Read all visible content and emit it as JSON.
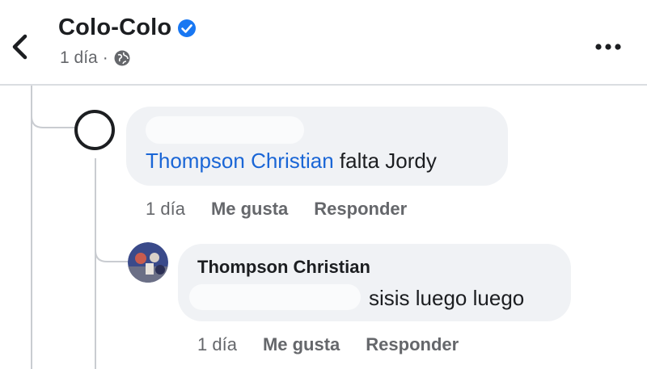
{
  "header": {
    "title": "Colo-Colo",
    "time": "1 día",
    "separator": "·"
  },
  "comments": [
    {
      "mention": "Thompson Christian",
      "text": " falta Jordy",
      "time": "1 día",
      "like": "Me gusta",
      "reply": "Responder"
    },
    {
      "author": "Thompson Christian",
      "text": "sisis luego luego",
      "time": "1 día",
      "like": "Me gusta",
      "reply": "Responder"
    }
  ],
  "colors": {
    "mention": "#1a66d6",
    "verified": "#1877f2",
    "bubble": "#f0f2f5",
    "muted": "#65676b"
  },
  "icons": [
    "back-arrow-icon",
    "verified-badge-icon",
    "globe-icon",
    "more-options-icon"
  ]
}
